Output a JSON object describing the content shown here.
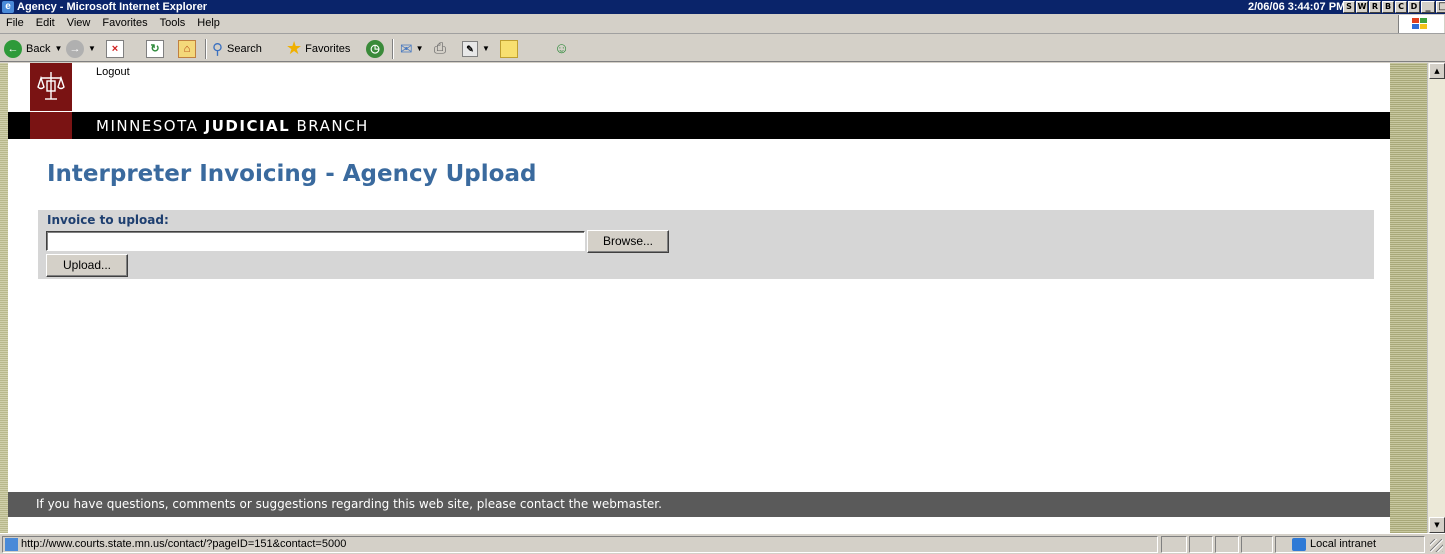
{
  "window": {
    "title": "Agency - Microsoft Internet Explorer",
    "clock": "2/06/06 3:44:07 PM",
    "extra_buttons": [
      "S",
      "W",
      "R",
      "B",
      "C",
      "D"
    ]
  },
  "menu": {
    "items": [
      "File",
      "Edit",
      "View",
      "Favorites",
      "Tools",
      "Help"
    ]
  },
  "toolbar": {
    "back_label": "Back",
    "search_label": "Search",
    "favorites_label": "Favorites"
  },
  "page": {
    "logout_label": "Logout",
    "brand_prefix": "MINNESOTA",
    "brand_bold": "JUDICIAL",
    "brand_suffix": "BRANCH",
    "title": "Interpreter Invoicing - Agency Upload",
    "upload": {
      "label": "Invoice to upload:",
      "file_value": "",
      "browse_label": "Browse...",
      "upload_label": "Upload..."
    },
    "footer_text": "If you have questions, comments or suggestions regarding this web site, please contact the webmaster."
  },
  "statusbar": {
    "url": "http://www.courts.state.mn.us/contact/?pageID=151&contact=5000",
    "zone": "Local intranet"
  },
  "colors": {
    "title_bar": "#0a246a",
    "brand_bar": "#000000",
    "logo_bg": "#7a1313",
    "page_title": "#3a6a9e",
    "upload_label": "#1e3f70",
    "footer_bg": "#5a5a5a"
  }
}
